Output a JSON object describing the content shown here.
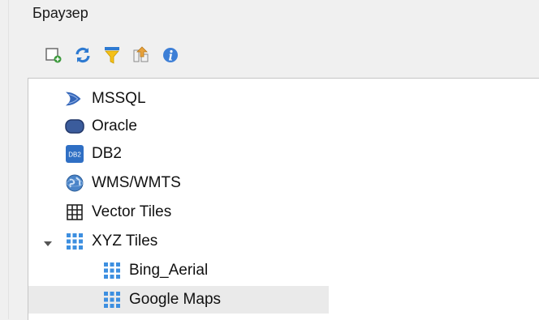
{
  "panel": {
    "title": "Браузер"
  },
  "toolbar": {
    "buttons": [
      {
        "name": "add-selected-layers-button",
        "icon": "add-layer-icon"
      },
      {
        "name": "refresh-button",
        "icon": "refresh-icon"
      },
      {
        "name": "filter-button",
        "icon": "filter-icon"
      },
      {
        "name": "collapse-all-button",
        "icon": "collapse-all-icon"
      },
      {
        "name": "properties-button",
        "icon": "info-icon"
      }
    ]
  },
  "tree": {
    "items": [
      {
        "label": "MSSQL",
        "icon": "mssql-icon"
      },
      {
        "label": "Oracle",
        "icon": "oracle-icon"
      },
      {
        "label": "DB2",
        "icon": "db2-icon",
        "badge": "DB2"
      },
      {
        "label": "WMS/WMTS",
        "icon": "globe-icon"
      },
      {
        "label": "Vector Tiles",
        "icon": "vector-tiles-icon"
      },
      {
        "label": "XYZ Tiles",
        "icon": "xyz-tiles-icon",
        "expanded": true
      },
      {
        "label": "Bing_Aerial",
        "icon": "xyz-tiles-icon"
      },
      {
        "label": "Google Maps",
        "icon": "xyz-tiles-icon",
        "selected": true
      }
    ]
  },
  "colors": {
    "accent_blue": "#2e7ad1",
    "tile_blue": "#3d8fe0",
    "green": "#3c9a3c",
    "selection": "#eaeaea"
  }
}
